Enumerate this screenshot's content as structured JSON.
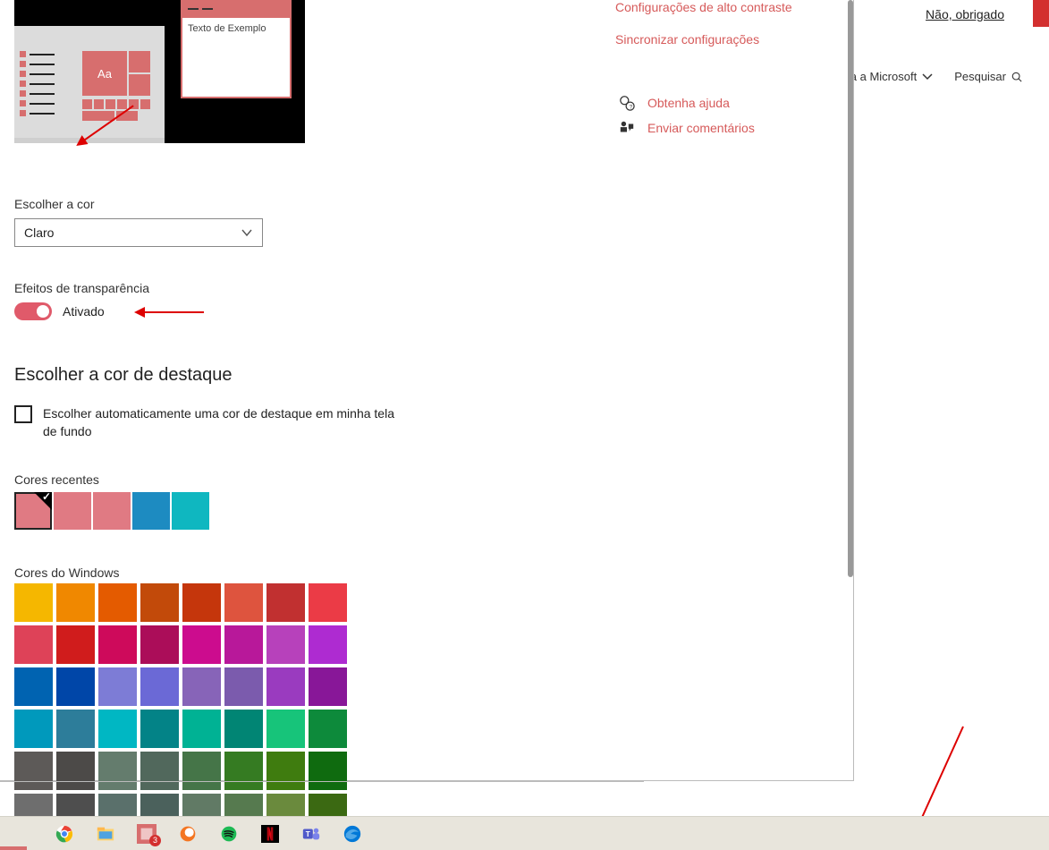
{
  "header": {
    "nao_obrigado": "Não, obrigado",
    "nav_microsoft": "a a Microsoft",
    "nav_search": "Pesquisar"
  },
  "settings": {
    "right_links": {
      "alto_contraste": "Configurações de alto contraste",
      "sincronizar": "Sincronizar configurações",
      "ajuda": "Obtenha ajuda",
      "comentarios": "Enviar comentários"
    },
    "preview": {
      "example_text": "Texto de Exemplo",
      "sample_Aa": "Aa"
    },
    "choose_color_label": "Escolher a cor",
    "choose_color_value": "Claro",
    "transparency_label": "Efeitos de transparência",
    "transparency_state": "Ativado",
    "accent_heading": "Escolher a cor de destaque",
    "auto_accent_label": "Escolher automaticamente uma cor de destaque em minha tela de fundo",
    "recent_label": "Cores recentes",
    "recent_colors": [
      "#e07a83",
      "#e07a83",
      "#e07a83",
      "#1d8bc1",
      "#0fb7c0"
    ],
    "windows_colors_label": "Cores do Windows",
    "windows_colors": [
      "#f5b700",
      "#f08800",
      "#e45b00",
      "#c24a0a",
      "#c5360c",
      "#de543e",
      "#c13030",
      "#eb3b46",
      "#de4258",
      "#d01c1c",
      "#ce0a5b",
      "#ab0d59",
      "#cc0c8e",
      "#b8189a",
      "#b741bb",
      "#ae2bd1",
      "#0063b1",
      "#0046a8",
      "#7d7cd6",
      "#6b69d6",
      "#8764b8",
      "#7b5bad",
      "#9a3bbf",
      "#881798",
      "#0099bc",
      "#2d7d9a",
      "#00b7c3",
      "#038387",
      "#00b294",
      "#018574",
      "#17c47a",
      "#0d8a3b",
      "#5d5a58",
      "#4c4a48",
      "#647c6d",
      "#51685c",
      "#457548",
      "#357b22",
      "#3f7c0f",
      "#0f6b0f",
      "#6e6e6e",
      "#4e4e4e",
      "#5a706b",
      "#4b615c",
      "#617a65",
      "#567a4f",
      "#6a8a3d",
      "#3b6912"
    ]
  },
  "taskbar": {
    "badge_count": "3"
  }
}
